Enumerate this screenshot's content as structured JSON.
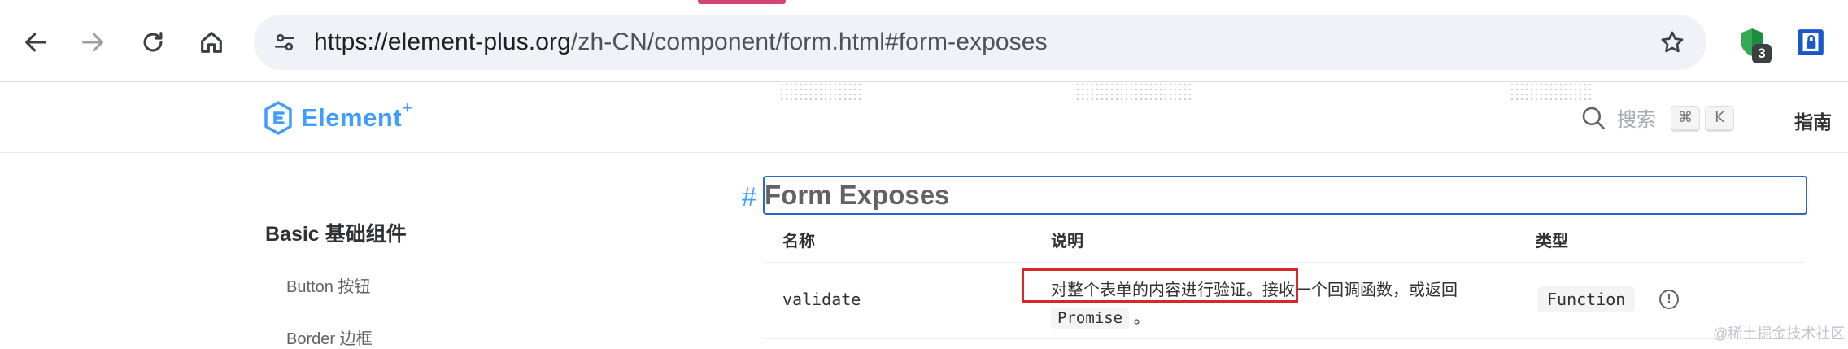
{
  "browser": {
    "url_host": "https://element-plus.org",
    "url_path": "/zh-CN/component/form.html#form-exposes",
    "extension_badge": "3",
    "accent_color": "#d3447a"
  },
  "nav": {
    "logo_text": "Element",
    "logo_plus": "+",
    "search_label": "搜索",
    "search_key1": "⌘",
    "search_key2": "K",
    "guide_label": "指南"
  },
  "sidebar": {
    "group_title": "Basic 基础组件",
    "items": [
      {
        "label": "Button 按钮"
      },
      {
        "label": "Border 边框"
      }
    ]
  },
  "content": {
    "anchor": "#",
    "heading": "Form Exposes",
    "columns": {
      "name": "名称",
      "desc": "说明",
      "type": "类型"
    },
    "row": {
      "name": "validate",
      "desc_part1": "对整个表单的内容进行验证。接收一个回调函数，或返回",
      "desc_code": "Promise",
      "desc_part2": "。",
      "type": "Function",
      "info_glyph": "!"
    }
  },
  "watermark": "@稀土掘金技术社区"
}
